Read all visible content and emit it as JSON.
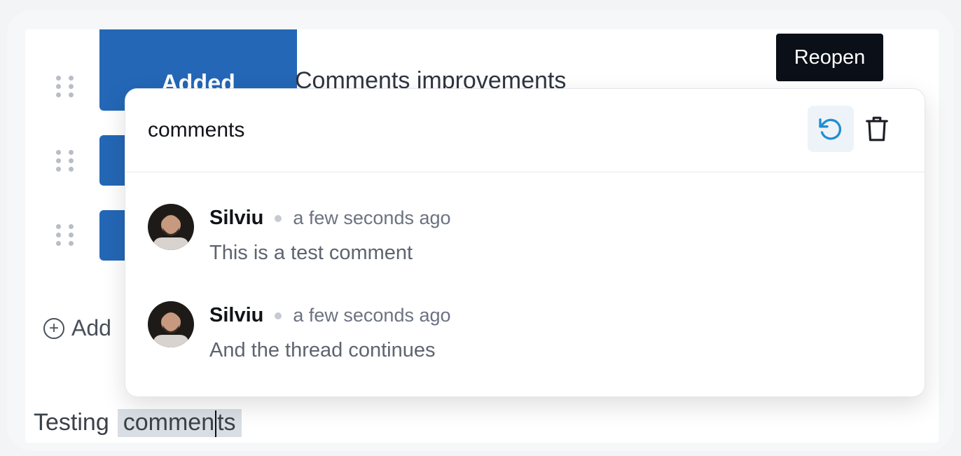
{
  "editor": {
    "rows": [
      {
        "status": ""
      },
      {
        "status": "Added",
        "title": "Comments improvements"
      },
      {
        "status": ""
      },
      {
        "status": ""
      }
    ],
    "add_label": "Add",
    "bottom_text_before": "Testing",
    "highlighted_before_cursor": "commen",
    "highlighted_after_cursor": "ts"
  },
  "tooltip": {
    "label": "Reopen"
  },
  "popup": {
    "title": "comments",
    "reopen_icon": "rotate-ccw-icon",
    "delete_icon": "trash-icon",
    "comments": [
      {
        "author": "Silviu",
        "time": "a few seconds ago",
        "text": "This is a test comment"
      },
      {
        "author": "Silviu",
        "time": "a few seconds ago",
        "text": "And the thread continues"
      }
    ]
  },
  "colors": {
    "status_button": "#2467b6",
    "tooltip_bg": "#0b0f17",
    "reopen_icon": "#1f8fd1",
    "highlight": "#d9dee5"
  }
}
